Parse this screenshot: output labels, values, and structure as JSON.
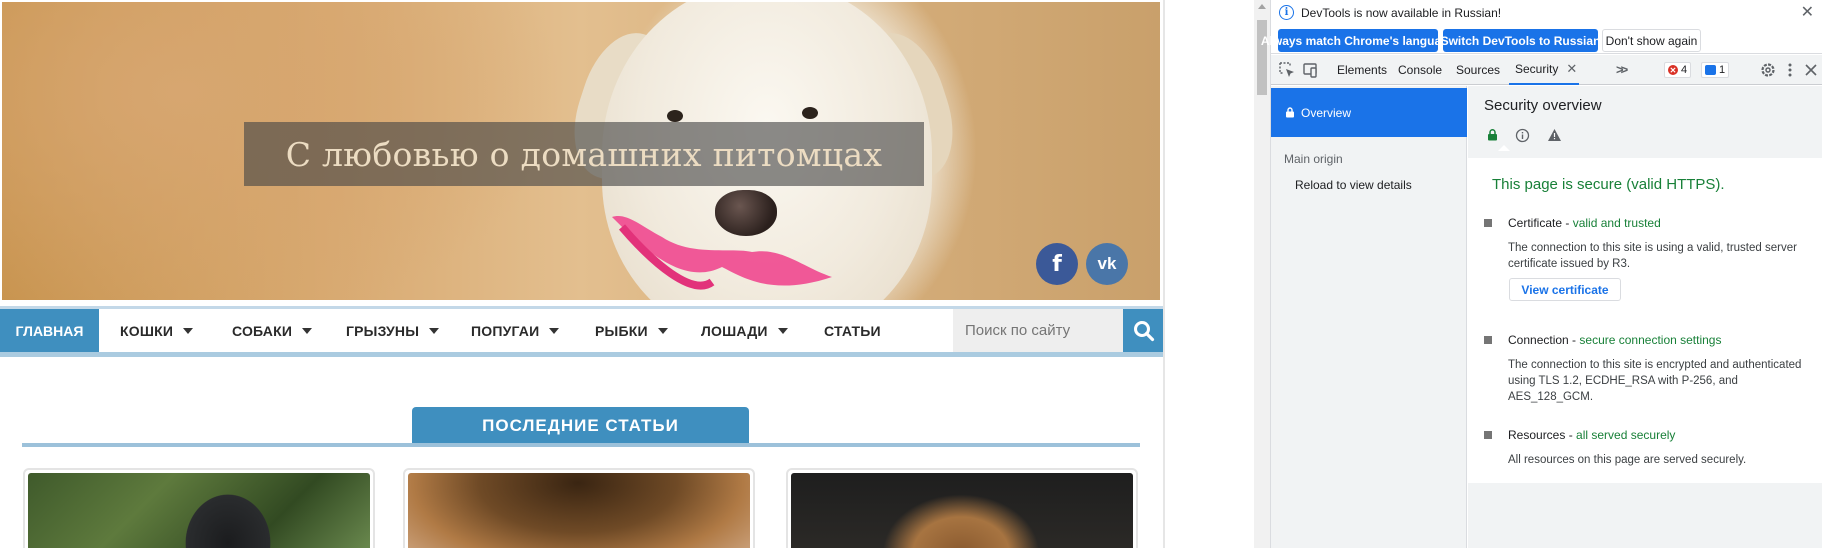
{
  "site": {
    "hero_title": "С любовью о домашних питомцах",
    "social": {
      "facebook": "f",
      "vk": "vk"
    },
    "nav": {
      "home": "ГЛАВНАЯ",
      "items": [
        "КОШКИ",
        "СОБАКИ",
        "ГРЫЗУНЫ",
        "ПОПУГАИ",
        "РЫБКИ",
        "ЛОШАДИ",
        "СТАТЬИ"
      ],
      "search_placeholder": "Поиск по сайту"
    },
    "latest_heading": "ПОСЛЕДНИЕ СТАТЬИ"
  },
  "devtools": {
    "infobar": {
      "text": "DevTools is now available in Russian!",
      "btn_match": "Always match Chrome's language",
      "btn_switch": "Switch DevTools to Russian",
      "btn_dont": "Don't show again"
    },
    "tabs": [
      "Elements",
      "Console",
      "Sources",
      "Security"
    ],
    "active_tab": "Security",
    "errors_count": "4",
    "messages_count": "1",
    "sidebar": {
      "overview": "Overview",
      "main_origin": "Main origin",
      "reload": "Reload to view details"
    },
    "security": {
      "title": "Security overview",
      "summary": "This page is secure (valid HTTPS).",
      "certificate": {
        "label": "Certificate",
        "status": "valid and trusted",
        "desc": "The connection to this site is using a valid, trusted server certificate issued by R3.",
        "button": "View certificate"
      },
      "connection": {
        "label": "Connection",
        "status": "secure connection settings",
        "desc": "The connection to this site is encrypted and authenticated using TLS 1.2, ECDHE_RSA with P-256, and AES_128_GCM."
      },
      "resources": {
        "label": "Resources",
        "status": "all served securely",
        "desc": "All resources on this page are served securely."
      }
    },
    "colors": {
      "accent": "#1a73e8",
      "secure_green": "#188038",
      "site_blue": "#3f8fbf"
    }
  }
}
